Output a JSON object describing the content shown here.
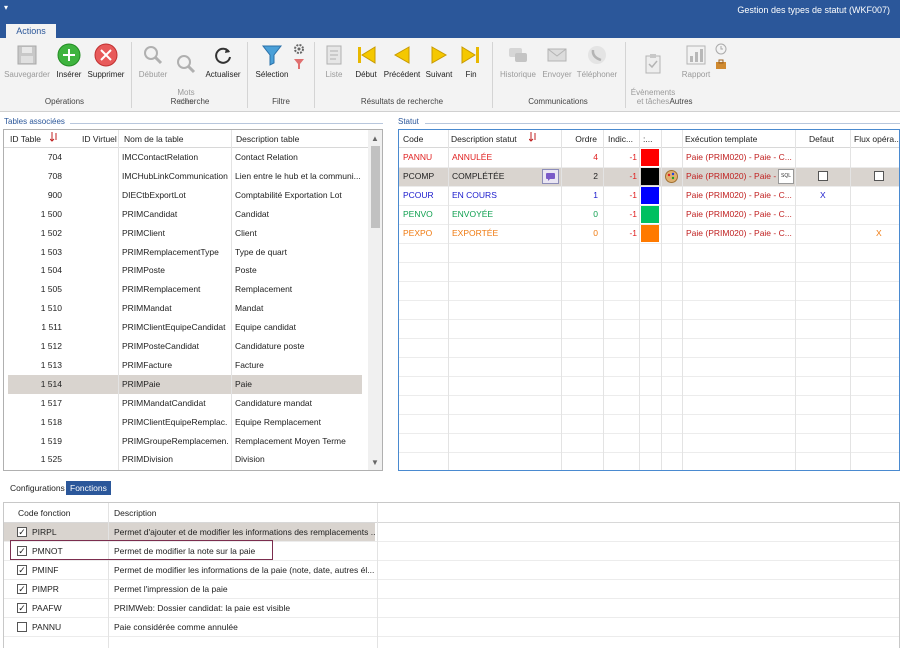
{
  "window": {
    "title": "Gestion des types de statut (WKF007)",
    "quick_access": "☰"
  },
  "ribbon_tab": "Actions",
  "ribbon": {
    "operations": {
      "label": "Opérations",
      "save": "Sauvegarder",
      "insert": "Insérer",
      "delete": "Supprimer"
    },
    "recherche": {
      "label": "Recherche",
      "start": "Débuter",
      "keywords": "Mots\nclés",
      "refresh": "Actualiser"
    },
    "filtre": {
      "label": "Filtre",
      "selection": "Sélection"
    },
    "resultats": {
      "label": "Résultats de recherche",
      "list": "Liste",
      "first": "Début",
      "prev": "Précédent",
      "next": "Suivant",
      "last": "Fin"
    },
    "communications": {
      "label": "Communications",
      "history": "Historique",
      "send": "Envoyer",
      "phone": "Téléphoner"
    },
    "autres": {
      "label": "Autres",
      "events": "Évènements\net tâches",
      "report": "Rapport"
    }
  },
  "tables_panel": {
    "title": "Tables associées",
    "columns": [
      "ID Table",
      "ID Virtuel",
      "Nom de la table",
      "Description table"
    ],
    "rows": [
      [
        "704",
        "",
        "IMCContactRelation",
        "Contact Relation"
      ],
      [
        "708",
        "",
        "IMCHubLinkCommunication",
        "Lien entre le hub et la communi..."
      ],
      [
        "900",
        "",
        "DIECtbExportLot",
        "Comptabilité Exportation Lot"
      ],
      [
        "1 500",
        "",
        "PRIMCandidat",
        "Candidat"
      ],
      [
        "1 502",
        "",
        "PRIMClient",
        "Client"
      ],
      [
        "1 503",
        "",
        "PRIMRemplacementType",
        "Type de quart"
      ],
      [
        "1 504",
        "",
        "PRIMPoste",
        "Poste"
      ],
      [
        "1 505",
        "",
        "PRIMRemplacement",
        "Remplacement"
      ],
      [
        "1 510",
        "",
        "PRIMMandat",
        "Mandat"
      ],
      [
        "1 511",
        "",
        "PRIMClientEquipeCandidat",
        "Equipe candidat"
      ],
      [
        "1 512",
        "",
        "PRIMPosteCandidat",
        "Candidature poste"
      ],
      [
        "1 513",
        "",
        "PRIMFacture",
        "Facture"
      ],
      [
        "1 514",
        "",
        "PRIMPaie",
        "Paie"
      ],
      [
        "1 517",
        "",
        "PRIMMandatCandidat",
        "Candidature mandat"
      ],
      [
        "1 518",
        "",
        "PRIMClientEquipeRemplac...",
        "Equipe Remplacement"
      ],
      [
        "1 519",
        "",
        "PRIMGroupeRemplacemen...",
        "Remplacement Moyen Terme"
      ],
      [
        "1 525",
        "",
        "PRIMDivision",
        "Division"
      ]
    ],
    "selected_row": 12
  },
  "statut_panel": {
    "title": "Statut",
    "columns": [
      "Code",
      "Description statut",
      "Ordre",
      "Indic...",
      ":...",
      "",
      "Exécution template",
      "Defaut",
      "Flux opéra..."
    ],
    "rows": [
      {
        "code": "PANNU",
        "desc": "ANNULÉE",
        "ordre": "4",
        "indic": "-1",
        "color": "#ff0000",
        "template": "Paie (PRIM020) - Paie - C...",
        "defaut": "",
        "flux": "",
        "text_color": "#e02020"
      },
      {
        "code": "PCOMP",
        "desc": "COMPLÉTÉE",
        "ordre": "2",
        "indic": "-1",
        "color": "#000000",
        "template": "Paie (PRIM020) - Paie - C",
        "defaut": "",
        "flux": "",
        "text_color": "#222222"
      },
      {
        "code": "PCOUR",
        "desc": "EN COURS",
        "ordre": "1",
        "indic": "-1",
        "color": "#0000ff",
        "template": "Paie (PRIM020) - Paie - C...",
        "defaut": "X",
        "flux": "",
        "text_color": "#1a1acc"
      },
      {
        "code": "PENVO",
        "desc": "ENVOYÉE",
        "ordre": "0",
        "indic": "-1",
        "color": "#00c060",
        "template": "Paie (PRIM020) - Paie - C...",
        "defaut": "",
        "flux": "",
        "text_color": "#10a050"
      },
      {
        "code": "PEXPO",
        "desc": "EXPORTÉE",
        "ordre": "0",
        "indic": "-1",
        "color": "#ff7a00",
        "template": "Paie (PRIM020) - Paie - C...",
        "defaut": "",
        "flux": "X",
        "text_color": "#ef7a10"
      }
    ]
  },
  "subtabs": [
    "Configurations",
    "Fonctions"
  ],
  "functions_panel": {
    "columns": [
      "Code fonction",
      "Description"
    ],
    "rows": [
      {
        "checked": true,
        "code": "PIRPL",
        "desc": "Permet d'ajouter et de modifier les informations des remplacements ..."
      },
      {
        "checked": true,
        "code": "PMNOT",
        "desc": "Permet de modifier la note sur la paie"
      },
      {
        "checked": true,
        "code": "PMINF",
        "desc": "Permet de modifier les informations de la paie (note, date, autres él..."
      },
      {
        "checked": true,
        "code": "PIMPR",
        "desc": "Permet l'impression de la paie"
      },
      {
        "checked": true,
        "code": "PAAFW",
        "desc": "PRIMWeb: Dossier candidat: la paie est visible"
      },
      {
        "checked": false,
        "code": "PANNU",
        "desc": "Paie considérée comme annulée"
      }
    ]
  }
}
